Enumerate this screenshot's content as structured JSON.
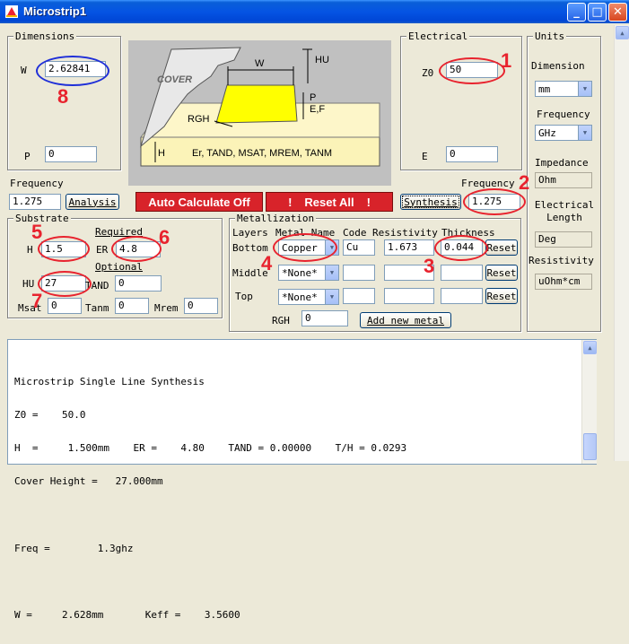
{
  "window": {
    "title": "Microstrip1"
  },
  "dimensions": {
    "group_title": "Dimensions",
    "w_label": "W",
    "w_value": "2.62841",
    "p_label": "P",
    "p_value": "0"
  },
  "diagram": {
    "cover": "COVER",
    "w": "W",
    "hu": "HU",
    "p": "P",
    "ef": "E,F",
    "rgh": "RGH",
    "h": "H",
    "substrate": "Er, TAND, MSAT, MREM, TANM"
  },
  "electrical": {
    "group_title": "Electrical",
    "z0_label": "Z0",
    "z0_value": "50",
    "e_label": "E",
    "e_value": "0"
  },
  "units": {
    "group_title": "Units",
    "dimension_label": "Dimension",
    "dimension_value": "mm",
    "frequency_label": "Frequency",
    "frequency_value": "GHz",
    "impedance_label": "Impedance",
    "impedance_value": "Ohm",
    "electrical_length_label": "Electrical Length",
    "electrical_length_value": "Deg",
    "resistivity_label": "Resistivity",
    "resistivity_value": "uOhm*cm"
  },
  "analysis": {
    "frequency_label": "Frequency",
    "frequency_value": "1.275",
    "analysis_button": "Analysis",
    "auto_calc_button": "Auto Calculate Off",
    "reset_all_button": "Reset  All",
    "reset_bang": "!",
    "synthesis_button": "Synthesis",
    "syn_frequency_label": "Frequency",
    "syn_frequency_value": "1.275"
  },
  "substrate": {
    "group_title": "Substrate",
    "required_label": "Required",
    "h_label": "H",
    "h_value": "1.5",
    "er_label": "ER",
    "er_value": "4.8",
    "optional_label": "Optional",
    "hu_label": "HU",
    "hu_value": "27",
    "tand_label": "TAND",
    "tand_value": "0",
    "msat_label": "Msat",
    "msat_value": "0",
    "tanm_label": "Tanm",
    "tanm_value": "0",
    "mrem_label": "Mrem",
    "mrem_value": "0"
  },
  "metallization": {
    "group_title": "Metallization",
    "headers": {
      "layers": "Layers",
      "metal_name": "Metal Name",
      "code": "Code",
      "resistivity": "Resistivity",
      "thickness": "Thickness"
    },
    "rows": [
      {
        "label": "Bottom",
        "metal": "Copper",
        "code": "Cu",
        "resistivity": "1.673",
        "thickness": "0.044",
        "reset": "Reset"
      },
      {
        "label": "Middle",
        "metal": "*None*",
        "code": "",
        "resistivity": "",
        "thickness": "",
        "reset": "Reset"
      },
      {
        "label": "Top",
        "metal": "*None*",
        "code": "",
        "resistivity": "",
        "thickness": "",
        "reset": "Reset"
      }
    ],
    "rgh_label": "RGH",
    "rgh_value": "0",
    "add_metal_button": "Add new metal"
  },
  "output": {
    "lines": [
      "Microstrip Single Line Synthesis",
      "Z0 =    50.0",
      "H  =     1.500mm    ER =    4.80    TAND = 0.00000    T/H = 0.0293",
      "Cover Height =   27.000mm",
      "",
      "Freq =        1.3ghz",
      "",
      "W =     2.628mm       Keff =    3.5600"
    ]
  },
  "annotations": [
    "1",
    "2",
    "3",
    "4",
    "5",
    "6",
    "7",
    "8"
  ],
  "colors": {
    "annotation_red": "#e8232e",
    "annotation_blue": "#1f2fd8",
    "xp_blue": "#0554e3",
    "button_red": "#d8232a"
  }
}
